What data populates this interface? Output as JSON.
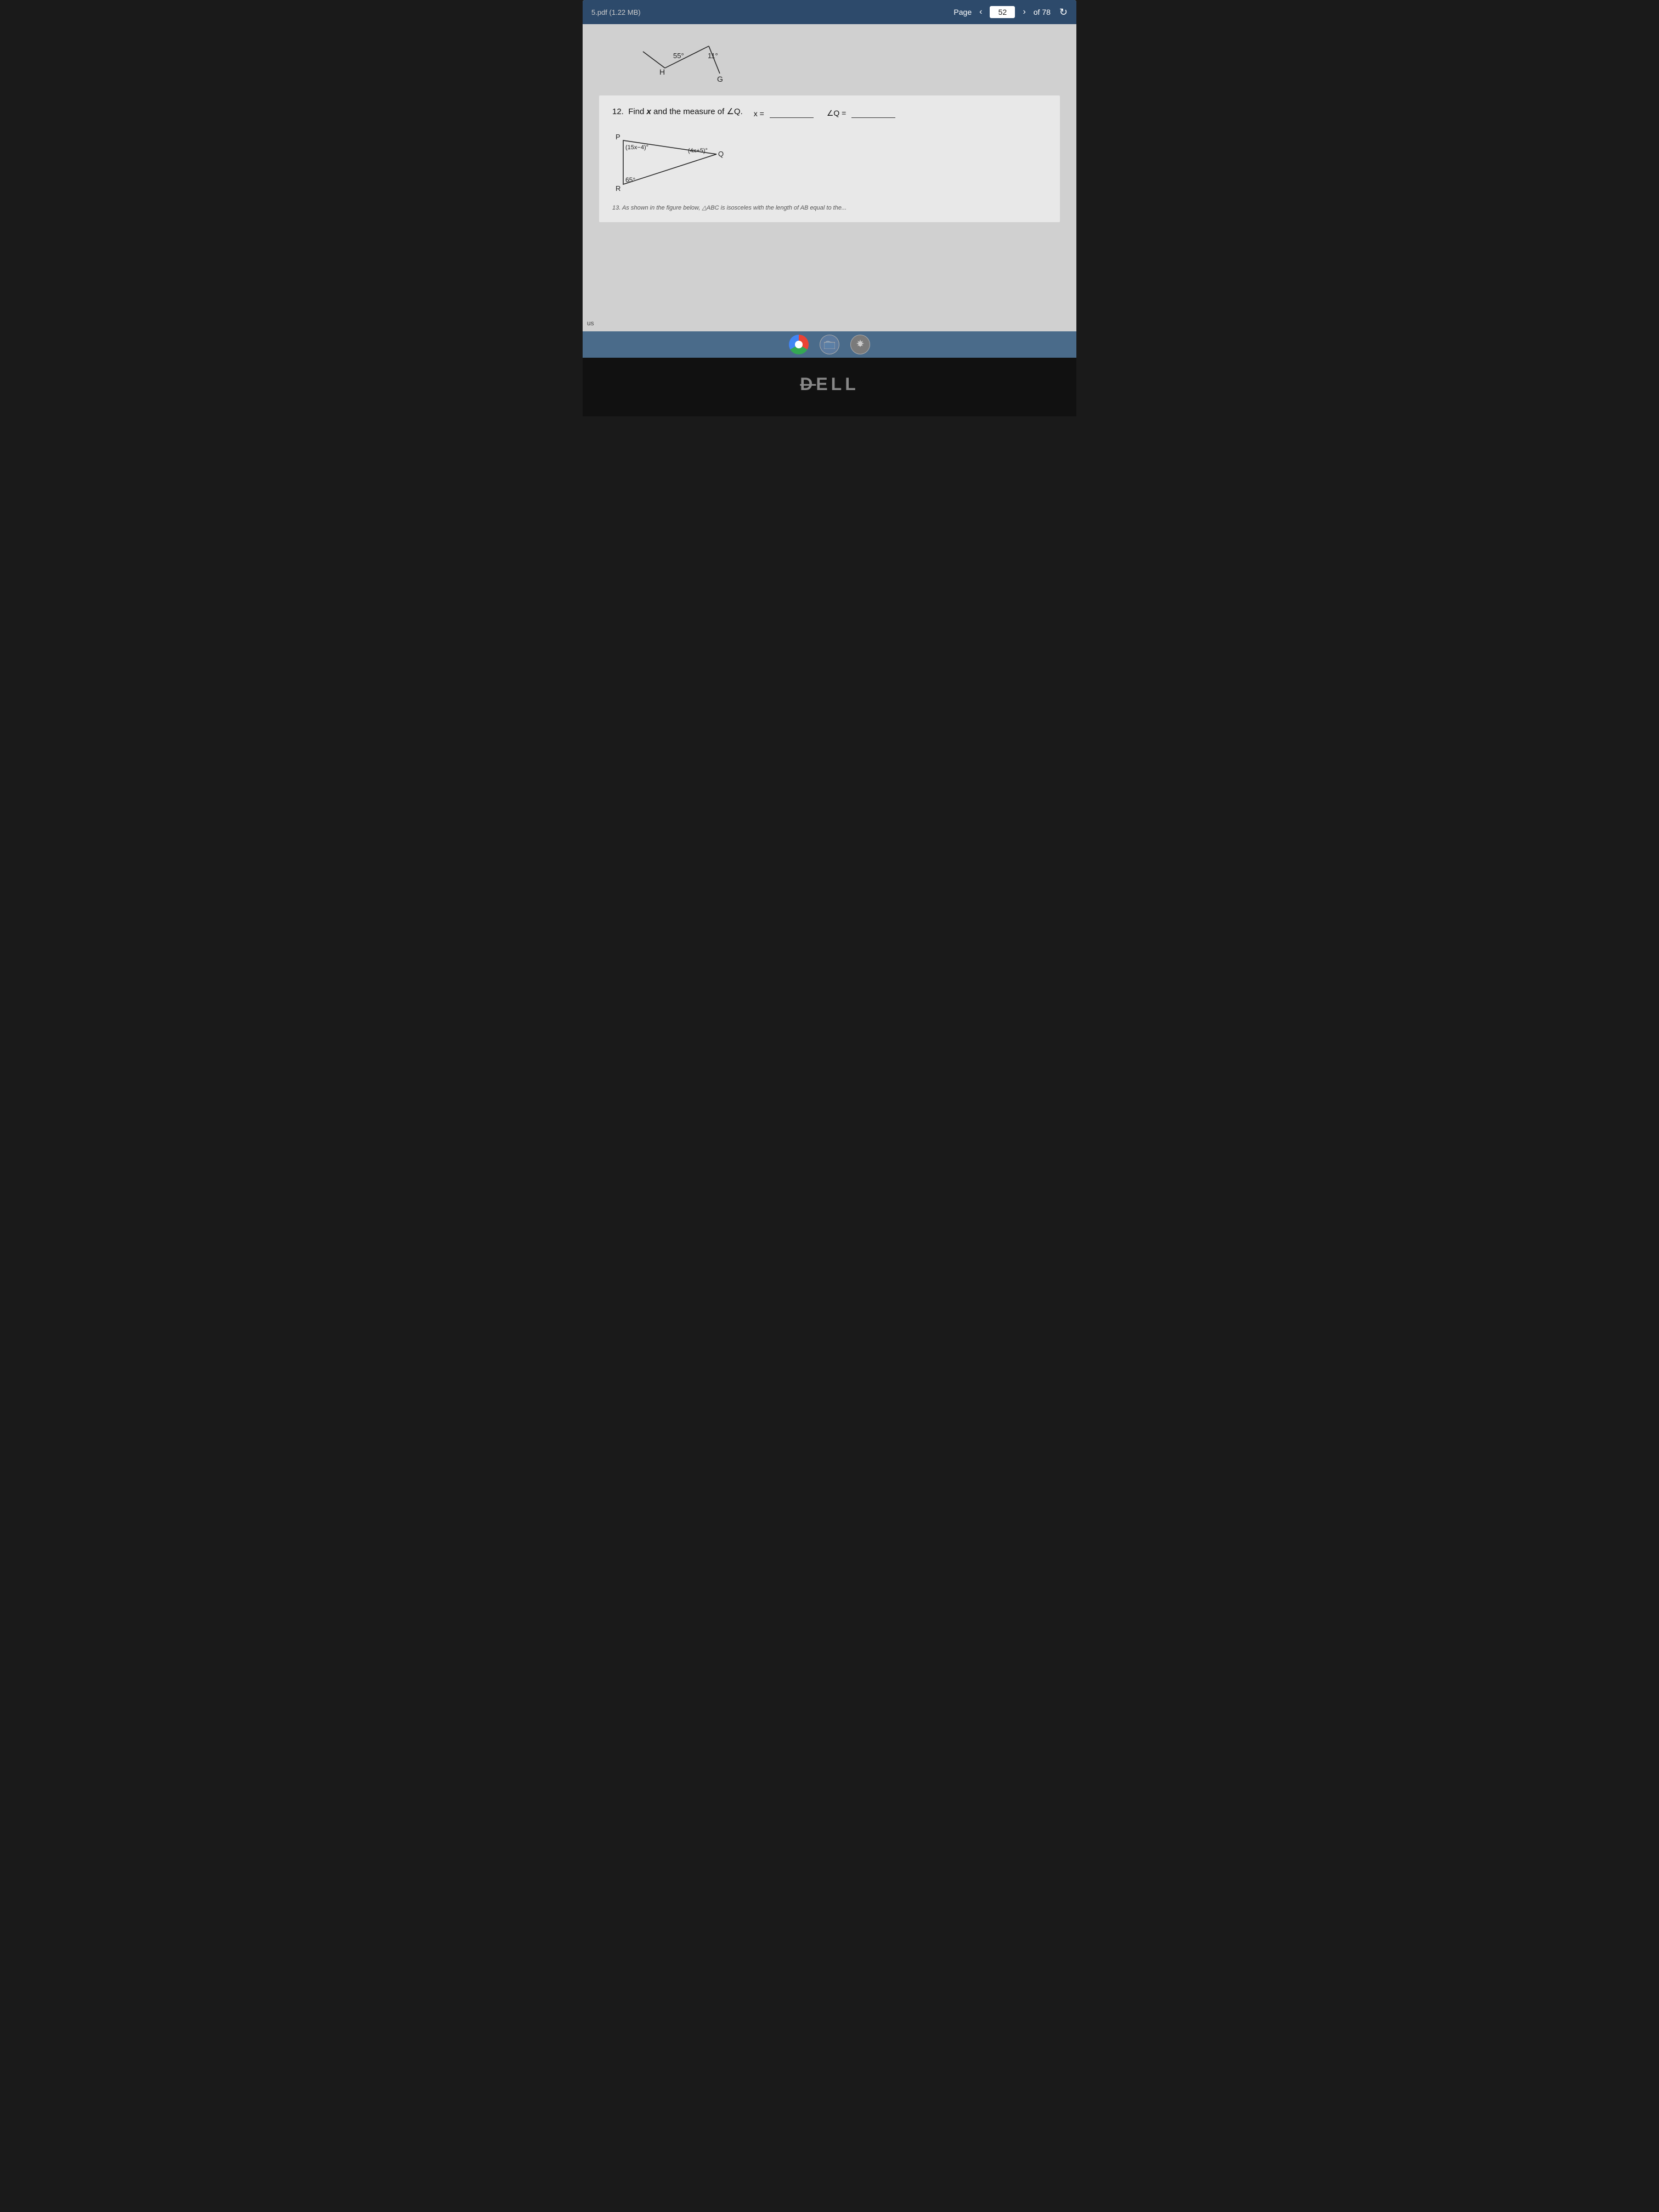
{
  "titlebar": {
    "filename": "5.pdf (1.22 MB)",
    "page_label": "Page",
    "page_current": "52",
    "page_of": "of 78"
  },
  "problem": {
    "number": "12.",
    "text": "Find x and the measure of ∠Q.",
    "top_figure": {
      "point_h": "H",
      "point_g": "G",
      "angle_55": "55°",
      "angle_11": "11°"
    },
    "triangle": {
      "point_p": "P",
      "point_q": "Q",
      "point_r": "R",
      "angle_p": "(15x−4)°",
      "angle_q": "(4x+5)°",
      "angle_r": "65°"
    },
    "answer_x_label": "x =",
    "answer_x_line": "",
    "answer_q_label": "∠Q =",
    "answer_q_line": ""
  },
  "bottom_text": "13. As shown in the figure below, △ABC is isosceles with the length of AB equal to the...",
  "taskbar": {
    "chrome_label": "Chrome",
    "files_label": "Files",
    "settings_label": "Settings"
  },
  "dell": {
    "logo": "DELL"
  },
  "status": {
    "label": "us"
  }
}
